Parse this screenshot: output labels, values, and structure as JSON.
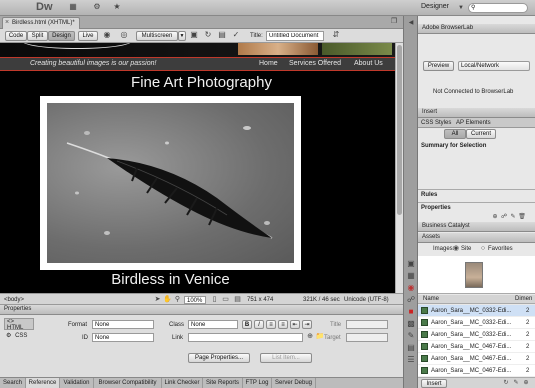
{
  "app": {
    "logo": "Dw",
    "workspace": "Designer",
    "search_placeholder": ""
  },
  "document": {
    "tab_title": "Birdless.html (XHTML)*",
    "view_buttons": [
      "Code",
      "Split",
      "Design",
      "Live"
    ],
    "multiscreen_label": "Multiscreen",
    "title_label": "Title:",
    "title_value": "Untitled Document"
  },
  "page": {
    "tagline": "Creating beautiful images is our passion!",
    "nav": [
      "Home",
      "Services Offered",
      "About Us"
    ],
    "heading": "Fine Art Photography",
    "caption": "Birdless in Venice"
  },
  "statusbar": {
    "tag": "<body>",
    "zoom": "100%",
    "dimensions": "751 x 474",
    "size_time": "321K / 46 sec",
    "encoding": "Unicode (UTF-8)"
  },
  "properties": {
    "title": "Properties",
    "html_label": "HTML",
    "css_label": "CSS",
    "format_label": "Format",
    "format_value": "None",
    "class_label": "Class",
    "class_value": "None",
    "id_label": "ID",
    "id_value": "None",
    "link_label": "Link",
    "title_field_label": "Title",
    "target_label": "Target",
    "page_properties_button": "Page Properties...",
    "list_item_button": "List Item..."
  },
  "bottom_tabs": [
    "Search",
    "Reference",
    "Validation",
    "Browser Compatibility",
    "Link Checker",
    "Site Reports",
    "FTP Log",
    "Server Debug"
  ],
  "right_panel": {
    "browserlab": {
      "title": "Adobe BrowserLab",
      "preview_button": "Preview",
      "source_select": "Local/Network",
      "status": "Not Connected to BrowserLab"
    },
    "insert_tab": "Insert",
    "css_tabs": [
      "CSS Styles",
      "AP Elements"
    ],
    "css_buttons": [
      "All",
      "Current"
    ],
    "summary_label": "Summary for Selection",
    "rules_label": "Rules",
    "properties_label": "Properties",
    "business_catalyst_tab": "Business Catalyst",
    "assets_tab": "Assets",
    "assets_images_label": "Images:",
    "radio_site": "Site",
    "radio_favorites": "Favorites",
    "col_name": "Name",
    "col_dimensions": "Dimen",
    "asset_files": [
      {
        "name": "Aaron_Sara__MC_0332-Edi...",
        "dim": "2"
      },
      {
        "name": "Aaron_Sara__MC_0332-Edi...",
        "dim": "2"
      },
      {
        "name": "Aaron_Sara__MC_0332-Edi...",
        "dim": "2"
      },
      {
        "name": "Aaron_Sara__MC_0467-Edi...",
        "dim": "2"
      },
      {
        "name": "Aaron_Sara__MC_0467-Edi...",
        "dim": "2"
      },
      {
        "name": "Aaron_Sara__MC_0467-Edi...",
        "dim": "2"
      }
    ],
    "insert_button": "Insert"
  }
}
